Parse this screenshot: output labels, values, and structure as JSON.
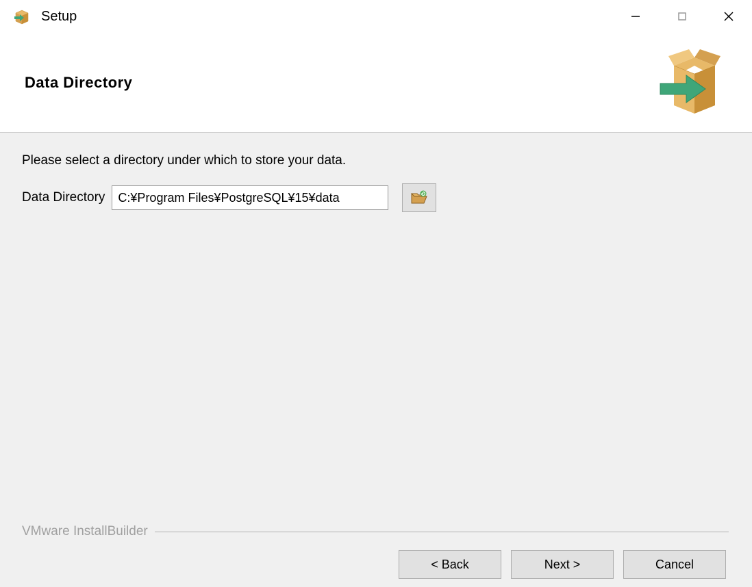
{
  "titlebar": {
    "title": "Setup"
  },
  "header": {
    "title": "Data Directory"
  },
  "content": {
    "instruction": "Please select a directory under which to store your data.",
    "field_label": "Data Directory",
    "field_value": "C:¥Program Files¥PostgreSQL¥15¥data"
  },
  "footer": {
    "branding": "VMware InstallBuilder",
    "back_label": "< Back",
    "next_label": "Next >",
    "cancel_label": "Cancel"
  },
  "colors": {
    "box_light": "#e8b968",
    "box_dark": "#c89038",
    "arrow": "#3fa679"
  }
}
